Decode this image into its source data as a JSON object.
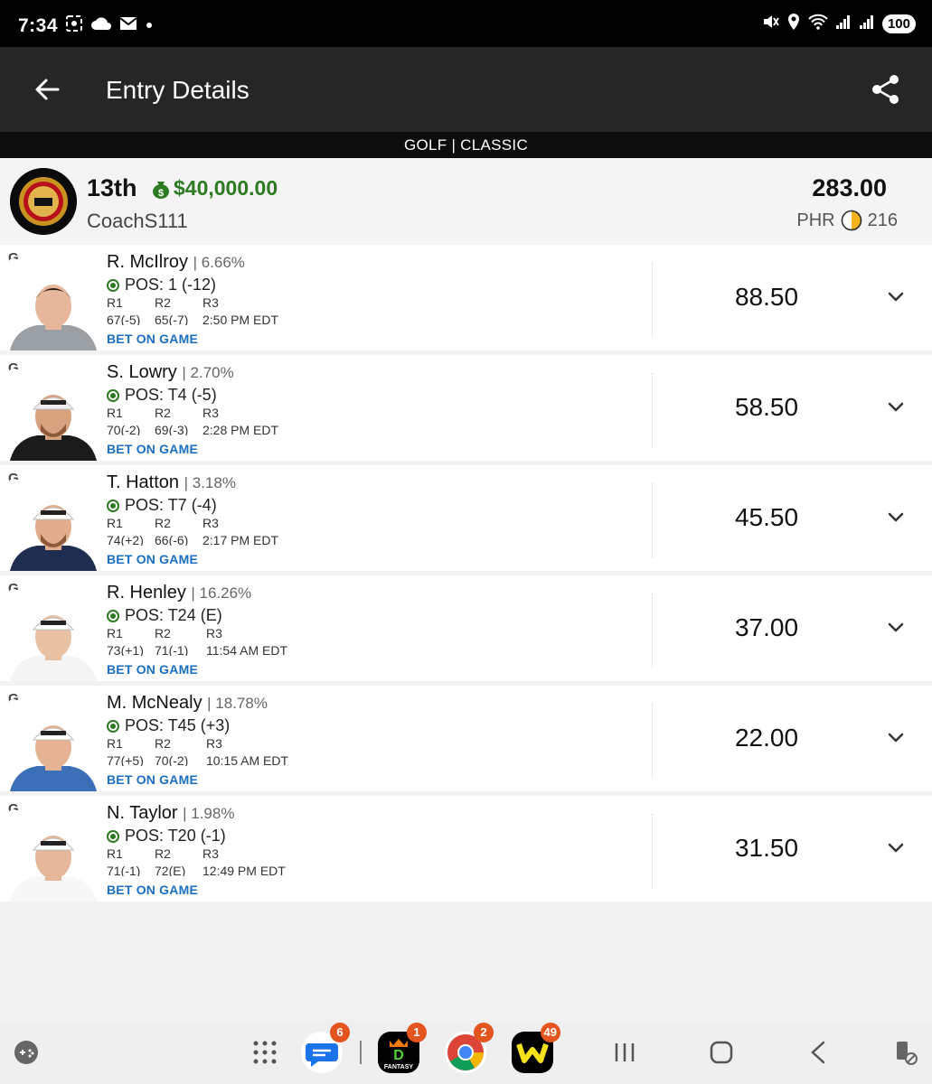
{
  "status_bar": {
    "time": "7:34",
    "battery": "100"
  },
  "app_bar": {
    "title": "Entry Details"
  },
  "sport_banner": "GOLF | CLASSIC",
  "entry": {
    "rank": "13th",
    "prize": "$40,000.00",
    "username": "CoachS111",
    "total_points": "283.00",
    "phr_label": "PHR",
    "phr_value": "216"
  },
  "round_labels": [
    "R1",
    "R2",
    "R3"
  ],
  "bet_label": "BET ON GAME",
  "players": [
    {
      "pos_tag": "G",
      "name": "R. McIlroy",
      "own": "| 6.66%",
      "position": "POS: 1 (-12)",
      "r1": "67(-5)",
      "r2": "65(-7)",
      "r3": "2:50 PM EDT",
      "points": "88.50"
    },
    {
      "pos_tag": "G",
      "name": "S. Lowry",
      "own": "| 2.70%",
      "position": "POS: T4 (-5)",
      "r1": "70(-2)",
      "r2": "69(-3)",
      "r3": "2:28 PM EDT",
      "points": "58.50"
    },
    {
      "pos_tag": "G",
      "name": "T. Hatton",
      "own": "| 3.18%",
      "position": "POS: T7 (-4)",
      "r1": "74(+2)",
      "r2": "66(-6)",
      "r3": "2:17 PM EDT",
      "points": "45.50"
    },
    {
      "pos_tag": "G",
      "name": "R. Henley",
      "own": "| 16.26%",
      "position": "POS: T24 (E)",
      "r1": "73(+1)",
      "r2": "71(-1)",
      "r3": "11:54 AM EDT",
      "points": "37.00"
    },
    {
      "pos_tag": "G",
      "name": "M. McNealy",
      "own": "| 18.78%",
      "position": "POS: T45 (+3)",
      "r1": "77(+5)",
      "r2": "70(-2)",
      "r3": "10:15 AM EDT",
      "points": "22.00"
    },
    {
      "pos_tag": "G",
      "name": "N. Taylor",
      "own": "| 1.98%",
      "position": "POS: T20 (-1)",
      "r1": "71(-1)",
      "r2": "72(E)",
      "r3": "12:49 PM EDT",
      "points": "31.50"
    }
  ],
  "dock": {
    "messages_badge": "6",
    "fantasy_badge": "1",
    "fantasy_label": "FANTASY",
    "chrome_badge": "2",
    "w_badge": "49"
  },
  "colors": {
    "app_bar": "#262626",
    "prize_green": "#2c7a21",
    "bet_link": "#1a6fc0",
    "badge": "#e3541e"
  }
}
